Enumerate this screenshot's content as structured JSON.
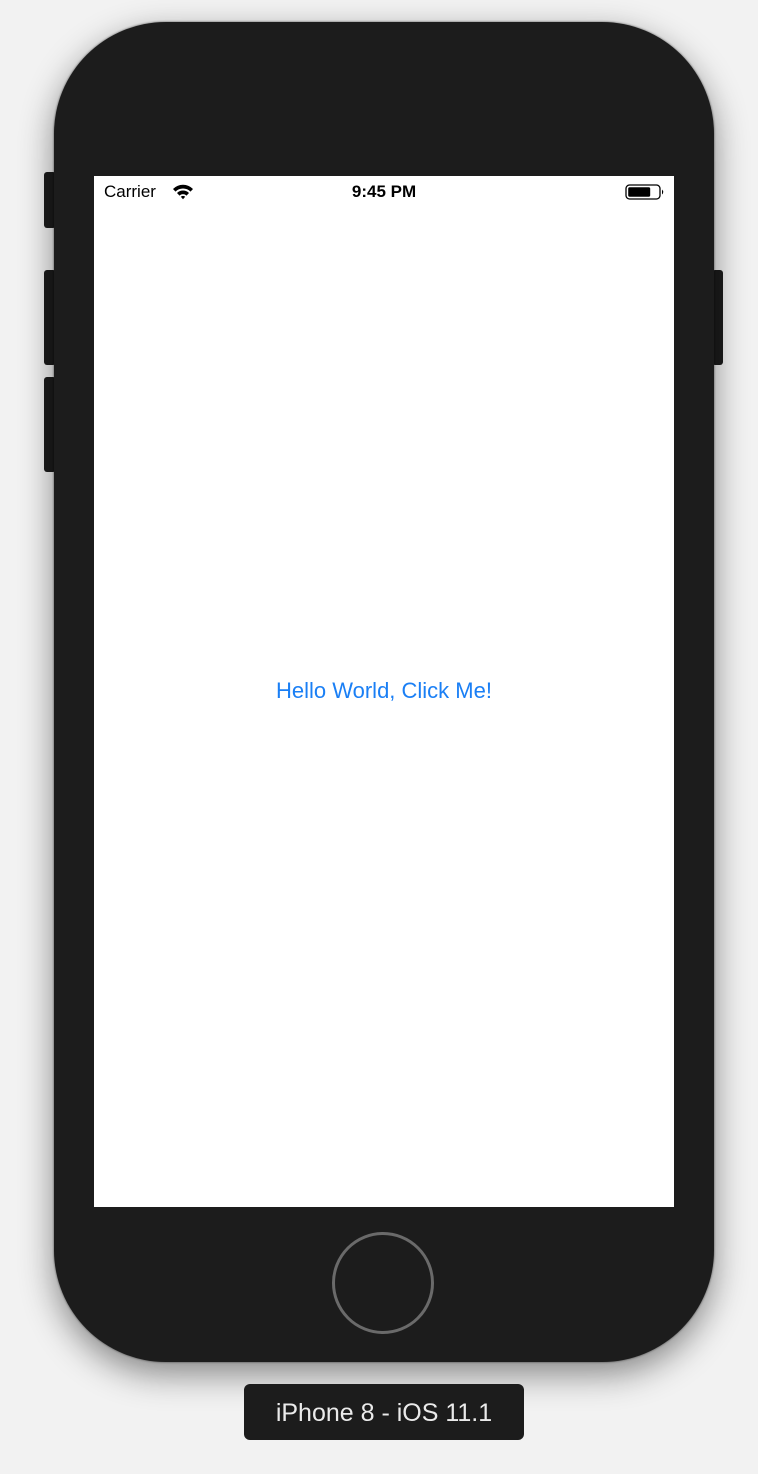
{
  "status_bar": {
    "carrier": "Carrier",
    "time": "9:45 PM",
    "wifi_icon": "wifi-icon",
    "battery_icon": "battery-icon"
  },
  "screen": {
    "button_label": "Hello World, Click Me!",
    "button_color": "#1a7ff5",
    "background": "#ffffff"
  },
  "device": {
    "label": "iPhone 8 - iOS 11.1",
    "body_color": "#1c1c1c",
    "home_button_icon": "home-button-icon"
  }
}
